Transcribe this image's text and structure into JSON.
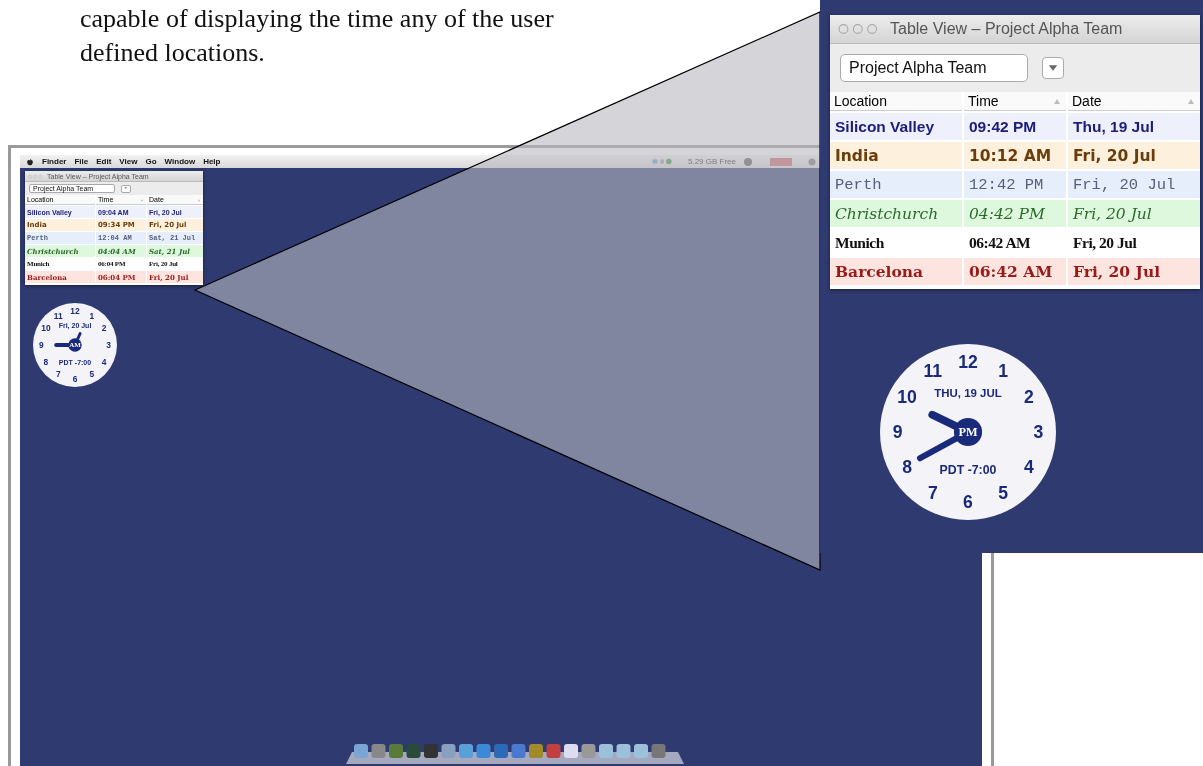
{
  "caption": {
    "lines": [
      "capable of displaying the time any of the user",
      "defined locations."
    ]
  },
  "screenshot": {
    "menu_bar": {
      "items": [
        "Finder",
        "File",
        "Edit",
        "View",
        "Go",
        "Window",
        "Help"
      ],
      "disk_status": "5.29 GB Free"
    },
    "window": {
      "title": "Table View – Project Alpha Team",
      "group": "Project Alpha Team",
      "columns": [
        "Location",
        "Time",
        "Date"
      ],
      "rows": [
        {
          "kind": "bold-sans",
          "color": "#1c1c7a",
          "location": "Silicon Valley",
          "time": "09:04 AM",
          "date": "Fri, 20 Jul"
        },
        {
          "kind": "casual",
          "color": "#6b3d0a",
          "location": "India",
          "time": "09:34 PM",
          "date": "Fri, 20 Jul"
        },
        {
          "kind": "mono",
          "color": "#55607a",
          "location": "Perth",
          "time": "12:04 AM",
          "date": "Sat, 21 Jul"
        },
        {
          "kind": "script",
          "color": "#2a6a2a",
          "location": "Christchurch",
          "time": "04:04 AM",
          "date": "Sat, 21 Jul"
        },
        {
          "kind": "blackletter",
          "color": "#111111",
          "location": "Munich",
          "time": "06:04 PM",
          "date": "Fri, 20 Jul"
        },
        {
          "kind": "bold-serif",
          "color": "#9a1a1a",
          "location": "Barcelona",
          "time": "06:04 PM",
          "date": "Fri, 20 Jul"
        }
      ]
    },
    "clock": {
      "numbers": [
        "11",
        "12",
        "1",
        "10",
        "2",
        "9",
        "3",
        "8",
        "4",
        "7",
        "5",
        "6"
      ],
      "date": "Fri, 20 Jul",
      "meridiem": "AM",
      "zone": "PDT -7:00"
    }
  },
  "zoom_inset": {
    "window": {
      "title": "Table View – Project Alpha Team",
      "group": "Project Alpha Team",
      "columns": [
        "Location",
        "Time",
        "Date"
      ],
      "rows": [
        {
          "kind": "bold-sans",
          "color": "#1c1c7a",
          "location": "Silicon Valley",
          "time": "09:42 PM",
          "date": "Thu, 19 Jul"
        },
        {
          "kind": "casual",
          "color": "#6b3d0a",
          "location": "India",
          "time": "10:12 AM",
          "date": "Fri, 20 Jul"
        },
        {
          "kind": "mono",
          "color": "#55607a",
          "location": "Perth",
          "time": "12:42 PM",
          "date": "Fri, 20 Jul"
        },
        {
          "kind": "script",
          "color": "#2a6a2a",
          "location": "Christchurch",
          "time": "04:42 PM",
          "date": "Fri, 20 Jul"
        },
        {
          "kind": "blackletter",
          "color": "#111111",
          "location": "Munich",
          "time": "06:42 AM",
          "date": "Fri, 20 Jul"
        },
        {
          "kind": "bold-serif",
          "color": "#9a1a1a",
          "location": "Barcelona",
          "time": "06:42 AM",
          "date": "Fri, 20 Jul"
        }
      ]
    },
    "clock": {
      "numbers": [
        "11",
        "12",
        "1",
        "10",
        "2",
        "9",
        "3",
        "8",
        "4",
        "7",
        "5",
        "6"
      ],
      "date": "THU, 19 JUL",
      "meridiem": "PM",
      "zone": "PDT -7:00"
    }
  }
}
